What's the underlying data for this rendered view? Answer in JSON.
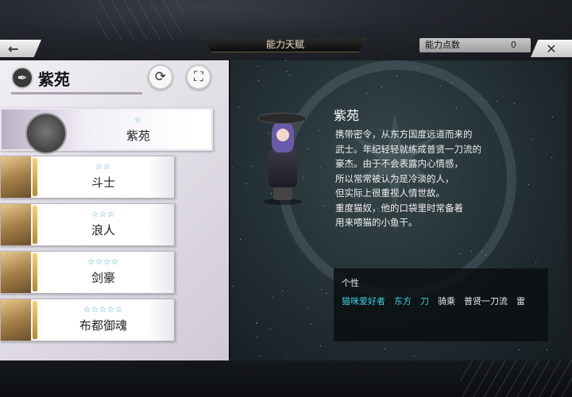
{
  "header": {
    "title": "能力天赋",
    "points_label": "能力点数",
    "points_value": "0",
    "back_icon": "arrow-left-icon",
    "close_icon": "close-icon"
  },
  "character": {
    "name": "紫苑",
    "refresh_icon": "refresh-icon",
    "fullscreen_icon": "expand-icon"
  },
  "jobs": [
    {
      "stars": "☆",
      "label": "紫苑",
      "selected": true
    },
    {
      "stars": "☆☆",
      "label": "斗士"
    },
    {
      "stars": "☆☆☆",
      "label": "浪人"
    },
    {
      "stars": "☆☆☆☆",
      "label": "剑豪"
    },
    {
      "stars": "☆☆☆☆☆",
      "label": "布都御魂"
    }
  ],
  "detail": {
    "name": "紫苑",
    "description": [
      "携带密令，从东方国度远道而来的",
      "武士。年纪轻轻就练成普贤一刀流的",
      "豪杰。由于不会表露内心情感，",
      "所以常常被认为是冷淡的人，",
      "但实际上很重视人情世故。",
      "重度猫奴，他的口袋里时常备着",
      "用来喂猫的小鱼干。"
    ],
    "traits_title": "个性",
    "traits": [
      {
        "label": "猫咪爱好者",
        "highlight": true
      },
      {
        "label": "东方",
        "highlight": true
      },
      {
        "label": "刀",
        "highlight": true
      },
      {
        "label": "骑乘",
        "highlight": false
      },
      {
        "label": "普贤一刀流",
        "highlight": false
      },
      {
        "label": "雷",
        "highlight": false
      }
    ]
  }
}
